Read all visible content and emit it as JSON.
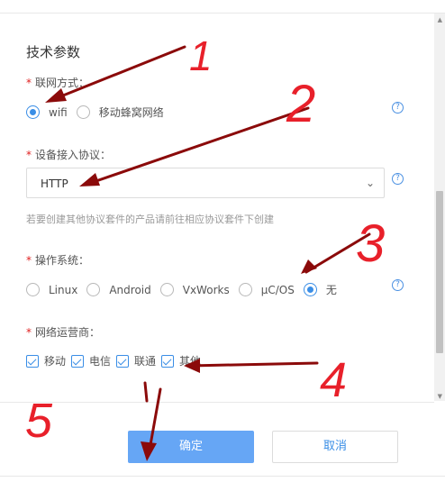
{
  "section": {
    "title": "技术参数"
  },
  "network_mode": {
    "label": "联网方式：",
    "options": [
      {
        "label": "wifi",
        "checked": true
      },
      {
        "label": "移动蜂窝网络",
        "checked": false
      }
    ]
  },
  "protocol": {
    "label": "设备接入协议：",
    "value": "HTTP",
    "hint": "若要创建其他协议套件的产品请前往相应协议套件下创建"
  },
  "os": {
    "label": "操作系统：",
    "options": [
      {
        "label": "Linux",
        "checked": false
      },
      {
        "label": "Android",
        "checked": false
      },
      {
        "label": "VxWorks",
        "checked": false
      },
      {
        "label": "μC/OS",
        "checked": false
      },
      {
        "label": "无",
        "checked": true
      }
    ]
  },
  "carrier": {
    "label": "网络运营商：",
    "options": [
      {
        "label": "移动",
        "checked": true
      },
      {
        "label": "电信",
        "checked": true
      },
      {
        "label": "联通",
        "checked": true
      },
      {
        "label": "其他",
        "checked": true
      }
    ]
  },
  "buttons": {
    "confirm": "确定",
    "cancel": "取消"
  },
  "annotations": {
    "n1": "1",
    "n2": "2",
    "n3": "3",
    "n4": "4",
    "n5": "5"
  },
  "colors": {
    "accent": "#3a8ee6",
    "primary_button": "#66a6f5",
    "required": "#e02020",
    "annotation_text": "#e8202a",
    "annotation_arrow": "#8b0a0a"
  }
}
